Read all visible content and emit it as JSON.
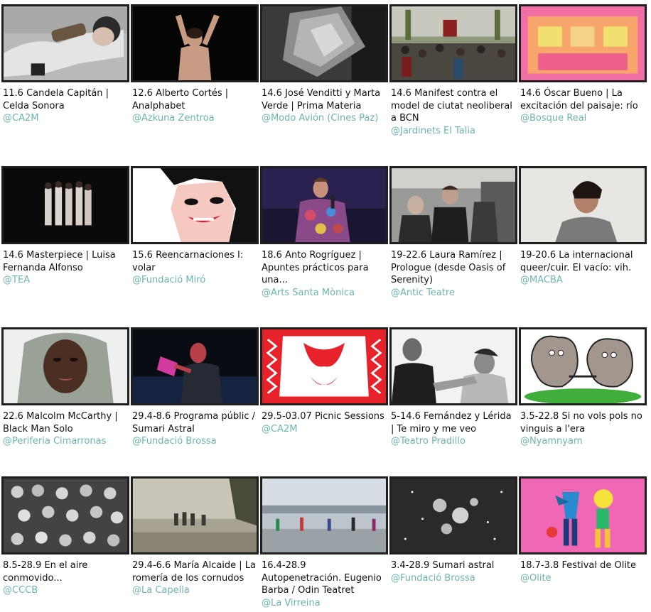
{
  "events": [
    {
      "title": "11.6 Candela Capitán | Celda Sonora",
      "venue": "@CA2M",
      "image": "performer-lying-floor-photo"
    },
    {
      "title": "12.6 Alberto Cortés | Analphabet",
      "venue": "@Azkuna Zentroa",
      "image": "performer-arms-raised-photo"
    },
    {
      "title": "14.6 José Venditti y Marta Verde | Prima Materia",
      "venue": "@Modo Avión (Cines Paz)",
      "image": "rock-monochrome-photo"
    },
    {
      "title": "14.6 Manifest contra el model de ciutat neoliberal a BCN",
      "venue": "@Jardinets El Talia",
      "image": "crowd-protest-photo"
    },
    {
      "title": "14.6 Óscar Bueno | La excitación del paisaje: río",
      "venue": "@Bosque Real",
      "image": "pink-facade-photo"
    },
    {
      "title": "14.6 Masterpiece | Luisa Fernanda Alfonso",
      "venue": "@TEA",
      "image": "dancers-stage-photo"
    },
    {
      "title": "15.6 Reencarnaciones I: volar",
      "venue": "@Fundació Miró",
      "image": "painted-face-illustration"
    },
    {
      "title": "18.6 Anto Rogríguez | Apuntes prácticos para una...",
      "venue": "@Arts Santa Mònica",
      "image": "singer-microphone-photo"
    },
    {
      "title": "19-22.6 Laura Ramírez | Prologue (desde Oasis of Serenity)",
      "venue": "@Antic Teatre",
      "image": "people-station-photo"
    },
    {
      "title": "19-20.6 La internacional queer/cuir. El vacío: vih.",
      "venue": "@MACBA",
      "image": "man-portrait-photo"
    },
    {
      "title": "22.6 Malcolm McCarthy | Black Man Solo",
      "venue": "@Periferia Cimarronas",
      "image": "hooded-man-portrait-photo"
    },
    {
      "title": "29.4-8.6 Programa públic / Sumari Astral",
      "venue": "@Fundació Brossa",
      "image": "performer-red-light-photo"
    },
    {
      "title": "29.5-03.07 Picnic Sessions",
      "venue": "@CA2M",
      "image": "red-pattern-poster"
    },
    {
      "title": "5-14.6 Fernández y Lérida | Te miro y me veo",
      "venue": "@Teatro Pradillo",
      "image": "two-dancers-monochrome-photo"
    },
    {
      "title": "3.5-22.8 Si no vols pols no vinguis a l'era",
      "venue": "@Nyamnyam",
      "image": "rock-characters-cartoon"
    },
    {
      "title": "8.5-28.9 En el aire conmovido...",
      "venue": "@CCCB",
      "image": "crowd-monochrome-photo"
    },
    {
      "title": "29.4-6.6 María Alcaide | La romería de los cornudos",
      "venue": "@La Capella",
      "image": "riders-mist-photo"
    },
    {
      "title": "16.4-28.9 Autopenetración. Eugenio Barba / Odin Teatret",
      "venue": "@La Virreina",
      "image": "street-performers-photo"
    },
    {
      "title": "3.4-28.9 Sumari astral",
      "venue": "@Fundació Brossa",
      "image": "star-cluster-photo"
    },
    {
      "title": "18.7-3.8 Festival de Olite",
      "venue": "@Olite",
      "image": "colorful-figures-illustration"
    }
  ]
}
